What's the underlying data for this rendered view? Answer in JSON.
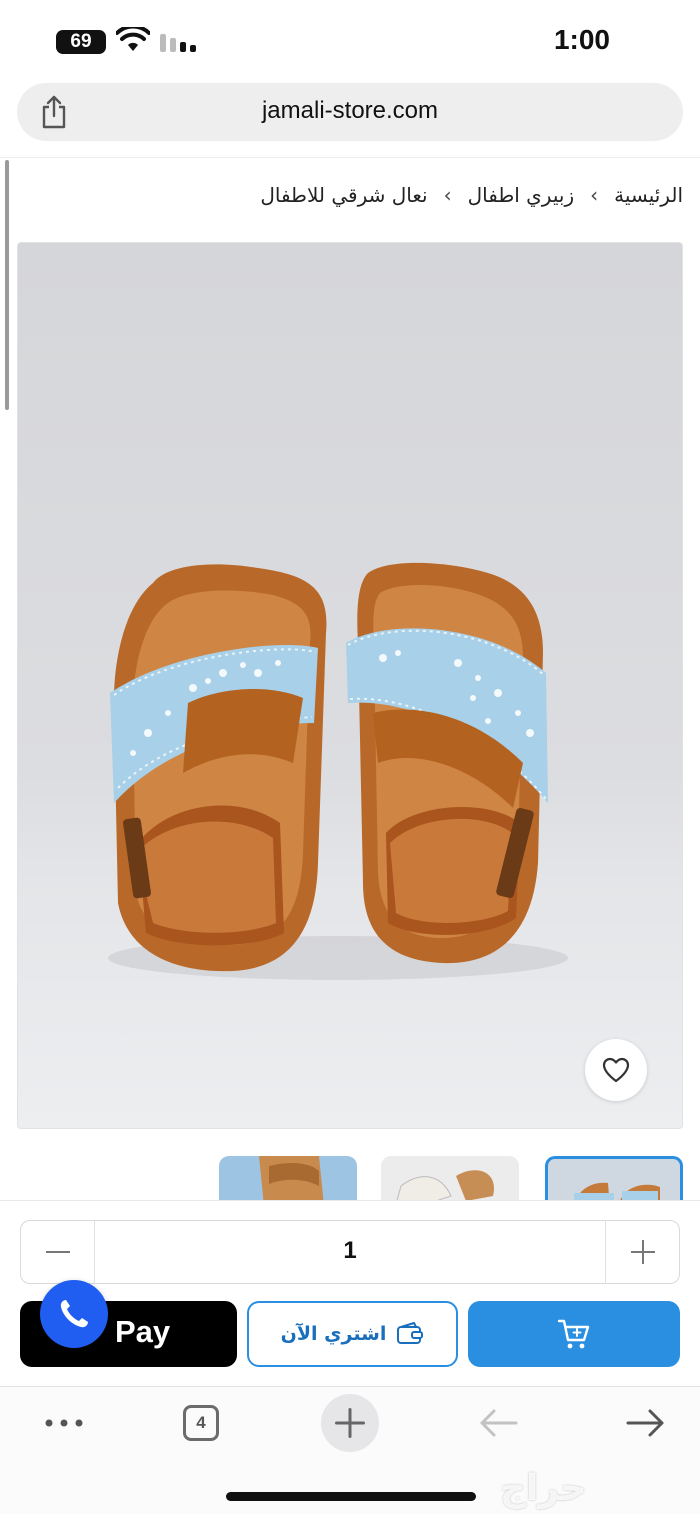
{
  "status_bar": {
    "battery_level": "69",
    "time": "1:00"
  },
  "browser": {
    "url": "jamali-store.com",
    "tabs_count": "4"
  },
  "breadcrumb": {
    "items": [
      {
        "label": "الرئيسية"
      },
      {
        "label": "زبيري اطفال"
      },
      {
        "label": "نعال شرقي للاطفال"
      }
    ],
    "separator": "›"
  },
  "product": {
    "image_subject": "children-sandals-tan-with-light-blue-embroidered-strap",
    "thumbnails_count": 3,
    "selected_thumbnail_index": 0
  },
  "purchase": {
    "quantity": "1",
    "apple_pay_label": "Pay",
    "buy_now_label": "اشتري الآن",
    "accent_color": "#2a8fe0"
  },
  "watermark": "حراج",
  "icons": {
    "share": "share-icon",
    "heart": "heart-icon",
    "cart": "cart-icon",
    "wallet": "wallet-icon",
    "whatsapp": "whatsapp-icon",
    "more": "more-dots-icon",
    "new_tab": "plus-icon",
    "back": "arrow-left-icon",
    "forward": "arrow-right-icon"
  }
}
